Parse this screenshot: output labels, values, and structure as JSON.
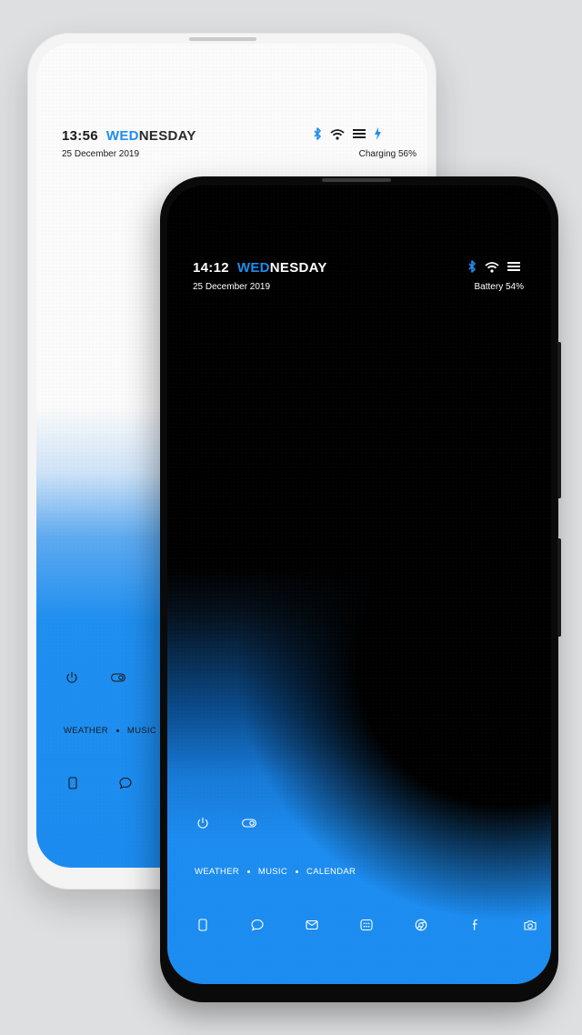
{
  "back_phone": {
    "time": "13:56",
    "day_accent": "WED",
    "day_rest": "NESDAY",
    "date": "25 December 2019",
    "battery_status": "Charging 56%",
    "links": [
      "WEATHER",
      "MUSIC"
    ],
    "status_icons": [
      "bluetooth-icon",
      "wifi-icon",
      "menu-icon",
      "charging-icon"
    ],
    "widget_icons": [
      "power-icon",
      "toggle-icon"
    ],
    "dock_icons": [
      "phone-icon",
      "chat-icon"
    ]
  },
  "front_phone": {
    "time": "14:12",
    "day_accent": "WED",
    "day_rest": "NESDAY",
    "date": "25 December 2019",
    "battery_status": "Battery 54%",
    "links": [
      "WEATHER",
      "MUSIC",
      "CALENDAR"
    ],
    "status_icons": [
      "bluetooth-icon",
      "wifi-icon",
      "menu-icon"
    ],
    "widget_icons": [
      "power-icon",
      "toggle-icon"
    ],
    "dock_icons": [
      "phone-icon",
      "chat-icon",
      "mail-icon",
      "apps-icon",
      "browser-icon",
      "facebook-icon",
      "camera-icon"
    ]
  },
  "colors": {
    "accent": "#1e8df0",
    "background": "#dedfe1"
  }
}
